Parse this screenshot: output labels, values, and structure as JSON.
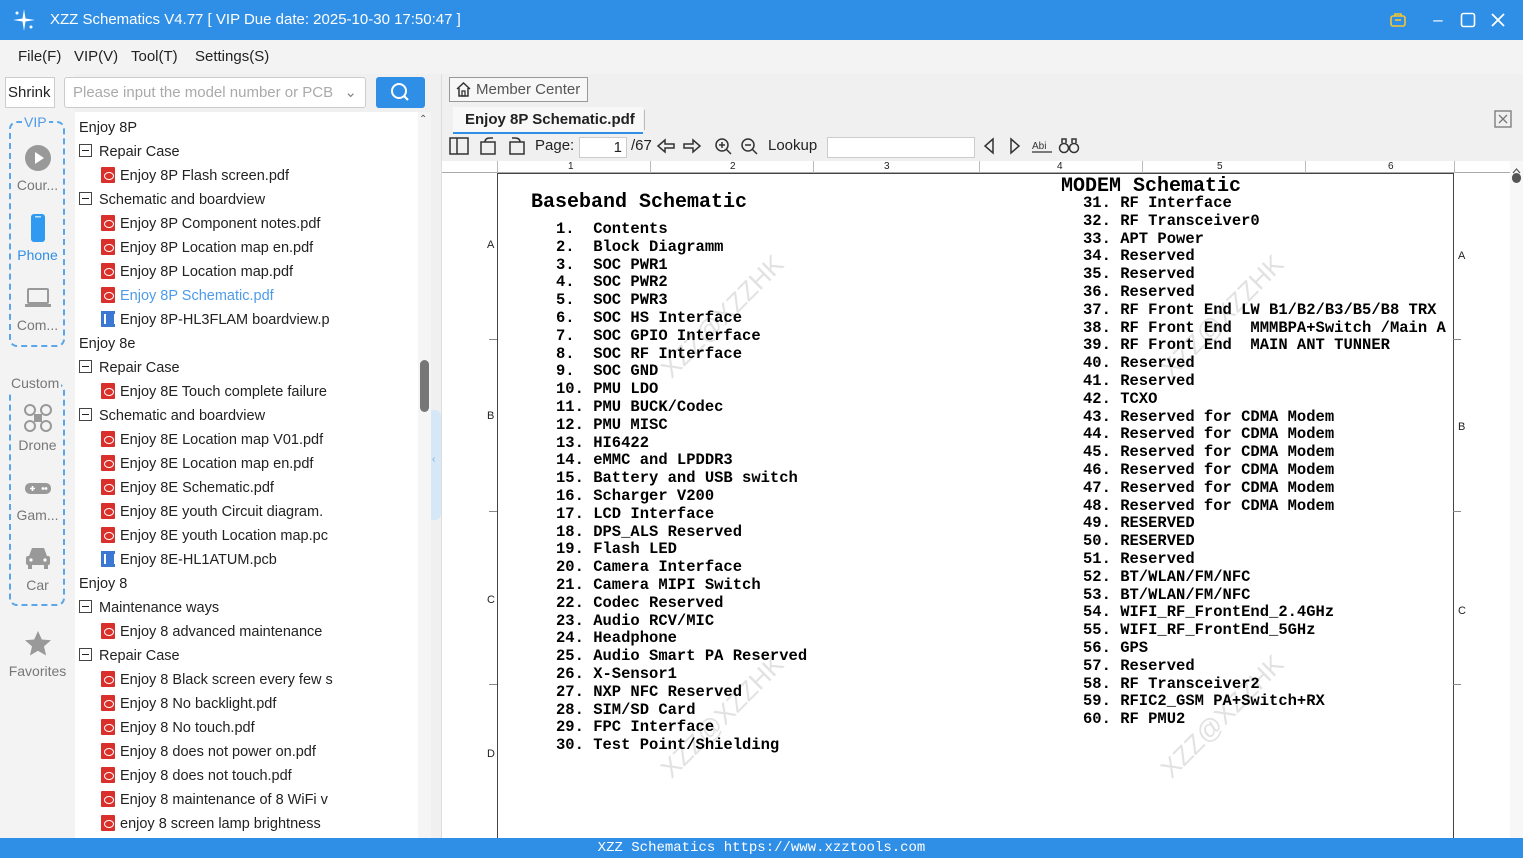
{
  "window": {
    "title": "XZZ Schematics V4.77 [ VIP Due date: 2025-10-30 17:50:47 ]"
  },
  "menu": [
    "File(F)",
    "VIP(V)",
    "Tool(T)",
    "Settings(S)"
  ],
  "search": {
    "shrink_label": "Shrink",
    "placeholder": "Please input the model number or PCB"
  },
  "sidebar": {
    "vip_group": "VIP",
    "custom_group": "Custom",
    "items": [
      {
        "label": "Cour...",
        "icon": "play-circle-icon"
      },
      {
        "label": "Phone",
        "icon": "phone-icon"
      },
      {
        "label": "Com...",
        "icon": "laptop-icon"
      },
      {
        "label": "Drone",
        "icon": "drone-icon"
      },
      {
        "label": "Gam...",
        "icon": "gamepad-icon"
      },
      {
        "label": "Car",
        "icon": "car-icon"
      },
      {
        "label": "Favorites",
        "icon": "star-icon"
      }
    ]
  },
  "tree": [
    {
      "level": 0,
      "kind": "folder",
      "label": "Enjoy 8P"
    },
    {
      "level": 1,
      "kind": "folder",
      "label": "Repair Case"
    },
    {
      "level": 2,
      "kind": "pdf",
      "label": "Enjoy 8P Flash screen.pdf"
    },
    {
      "level": 1,
      "kind": "folder",
      "label": "Schematic and boardview"
    },
    {
      "level": 2,
      "kind": "pdf",
      "label": "Enjoy 8P Component notes.pdf"
    },
    {
      "level": 2,
      "kind": "pdf",
      "label": "Enjoy 8P Location map en.pdf"
    },
    {
      "level": 2,
      "kind": "pdf",
      "label": "Enjoy 8P Location map.pdf"
    },
    {
      "level": 2,
      "kind": "pdf",
      "label": "Enjoy 8P Schematic.pdf",
      "selected": true
    },
    {
      "level": 2,
      "kind": "pcb",
      "label": "Enjoy 8P-HL3FLAM boardview.p"
    },
    {
      "level": 0,
      "kind": "folder",
      "label": "Enjoy 8e"
    },
    {
      "level": 1,
      "kind": "folder",
      "label": "Repair Case"
    },
    {
      "level": 2,
      "kind": "pdf",
      "label": "Enjoy 8E Touch complete failure"
    },
    {
      "level": 1,
      "kind": "folder",
      "label": "Schematic and boardview"
    },
    {
      "level": 2,
      "kind": "pdf",
      "label": "Enjoy 8E Location map V01.pdf"
    },
    {
      "level": 2,
      "kind": "pdf",
      "label": "Enjoy 8E Location map en.pdf"
    },
    {
      "level": 2,
      "kind": "pdf",
      "label": "Enjoy 8E Schematic.pdf"
    },
    {
      "level": 2,
      "kind": "pdf",
      "label": "Enjoy 8E youth Circuit diagram."
    },
    {
      "level": 2,
      "kind": "pdf",
      "label": "Enjoy 8E youth Location map.pc"
    },
    {
      "level": 2,
      "kind": "pcb",
      "label": "Enjoy 8E-HL1ATUM.pcb"
    },
    {
      "level": 0,
      "kind": "folder",
      "label": "Enjoy 8"
    },
    {
      "level": 1,
      "kind": "folder",
      "label": "Maintenance ways"
    },
    {
      "level": 2,
      "kind": "pdf",
      "label": "Enjoy 8 advanced maintenance"
    },
    {
      "level": 1,
      "kind": "folder",
      "label": "Repair Case"
    },
    {
      "level": 2,
      "kind": "pdf",
      "label": "Enjoy 8 Black screen every few s"
    },
    {
      "level": 2,
      "kind": "pdf",
      "label": "Enjoy 8 No backlight.pdf"
    },
    {
      "level": 2,
      "kind": "pdf",
      "label": "Enjoy 8 No touch.pdf"
    },
    {
      "level": 2,
      "kind": "pdf",
      "label": "Enjoy 8 does not power on.pdf"
    },
    {
      "level": 2,
      "kind": "pdf",
      "label": "Enjoy 8 does not touch.pdf"
    },
    {
      "level": 2,
      "kind": "pdf",
      "label": "Enjoy 8 maintenance of 8 WiFi v"
    },
    {
      "level": 2,
      "kind": "pdf",
      "label": "enjoy 8 screen lamp brightness"
    }
  ],
  "viewer": {
    "member_center": "Member Center",
    "tab_title": "Enjoy 8P Schematic.pdf",
    "page_label": "Page:",
    "page_current": "1",
    "page_total": "/67",
    "lookup_label": "Lookup",
    "ruler": [
      "1",
      "2",
      "3",
      "4",
      "5",
      "6"
    ],
    "side_letters": [
      "A",
      "B",
      "C",
      "D"
    ],
    "watermark": "XZZ@XZZHK"
  },
  "document": {
    "baseband_title": "Baseband Schematic",
    "modem_title": "MODEM Schematic",
    "baseband_items": [
      "1.  Contents",
      "2.  Block Diagramm",
      "3.  SOC PWR1",
      "4.  SOC PWR2",
      "5.  SOC PWR3",
      "6.  SOC HS Interface",
      "7.  SOC GPIO Interface",
      "8.  SOC RF Interface",
      "9.  SOC GND",
      "10. PMU LDO",
      "11. PMU BUCK/Codec",
      "12. PMU MISC",
      "13. HI6422",
      "14. eMMC and LPDDR3",
      "15. Battery and USB switch",
      "16. Scharger V200",
      "17. LCD Interface",
      "18. DPS_ALS Reserved",
      "19. Flash LED",
      "20. Camera Interface",
      "21. Camera MIPI Switch",
      "22. Codec Reserved",
      "23. Audio RCV/MIC",
      "24. Headphone",
      "25. Audio Smart PA Reserved",
      "26. X-Sensor1",
      "27. NXP NFC Reserved",
      "28. SIM/SD Card",
      "29. FPC Interface",
      "30. Test Point/Shielding"
    ],
    "modem_items": [
      "31. RF Interface",
      "32. RF Transceiver0",
      "33. APT Power",
      "34. Reserved",
      "35. Reserved",
      "36. Reserved",
      "37. RF Front End LW B1/B2/B3/B5/B8 TRX",
      "38. RF Front End  MMMBPA+Switch /Main A",
      "39. RF Front End  MAIN ANT TUNNER",
      "40. Reserved",
      "41. Reserved",
      "42. TCXO",
      "43. Reserved for CDMA Modem",
      "44. Reserved for CDMA Modem",
      "45. Reserved for CDMA Modem",
      "46. Reserved for CDMA Modem",
      "47. Reserved for CDMA Modem",
      "48. Reserved for CDMA Modem",
      "49. RESERVED",
      "50. RESERVED",
      "51. Reserved",
      "52. BT/WLAN/FM/NFC",
      "53. BT/WLAN/FM/NFC",
      "54. WIFI_RF_FrontEnd_2.4GHz",
      "55. WIFI_RF_FrontEnd_5GHz",
      "56. GPS",
      "57. Reserved",
      "58. RF Transceiver2",
      "59. RFIC2_GSM PA+Switch+RX",
      "60. RF PMU2"
    ]
  },
  "status": {
    "text": "XZZ Schematics https://www.xzztools.com"
  },
  "colors": {
    "accent": "#2f8ee5",
    "selected": "#4d9be9",
    "pdf": "#d9302c"
  }
}
